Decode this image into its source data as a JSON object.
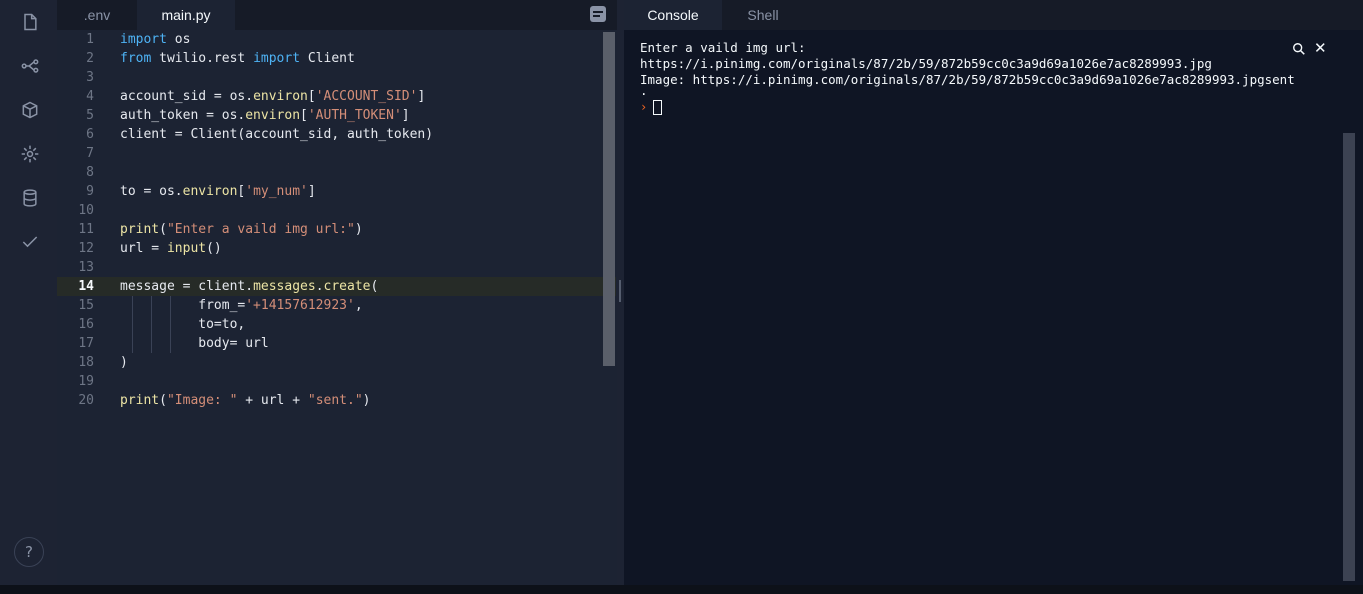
{
  "editor": {
    "tabs": [
      ".env",
      "main.py"
    ],
    "active_tab": "main.py",
    "active_line": 14,
    "lines": [
      [
        {
          "t": "import",
          "c": "kw"
        },
        {
          "t": " os",
          "c": ""
        }
      ],
      [
        {
          "t": "from",
          "c": "kw"
        },
        {
          "t": " twilio.rest ",
          "c": ""
        },
        {
          "t": "import",
          "c": "kw"
        },
        {
          "t": " Client",
          "c": ""
        }
      ],
      [],
      [
        {
          "t": "account_sid = os.",
          "c": ""
        },
        {
          "t": "environ",
          "c": "fn"
        },
        {
          "t": "[",
          "c": ""
        },
        {
          "t": "'ACCOUNT_SID'",
          "c": "str"
        },
        {
          "t": "]",
          "c": ""
        }
      ],
      [
        {
          "t": "auth_token = os.",
          "c": ""
        },
        {
          "t": "environ",
          "c": "fn"
        },
        {
          "t": "[",
          "c": ""
        },
        {
          "t": "'AUTH_TOKEN'",
          "c": "str"
        },
        {
          "t": "]",
          "c": ""
        }
      ],
      [
        {
          "t": "client = Client(account_sid, auth_token)",
          "c": ""
        }
      ],
      [],
      [],
      [
        {
          "t": "to = os.",
          "c": ""
        },
        {
          "t": "environ",
          "c": "fn"
        },
        {
          "t": "[",
          "c": ""
        },
        {
          "t": "'my_num'",
          "c": "str"
        },
        {
          "t": "]",
          "c": ""
        }
      ],
      [],
      [
        {
          "t": "print",
          "c": "fn"
        },
        {
          "t": "(",
          "c": ""
        },
        {
          "t": "\"Enter a vaild img url:\"",
          "c": "str"
        },
        {
          "t": ")",
          "c": ""
        }
      ],
      [
        {
          "t": "url = ",
          "c": ""
        },
        {
          "t": "input",
          "c": "fn"
        },
        {
          "t": "()",
          "c": ""
        }
      ],
      [],
      [
        {
          "t": "message = client.",
          "c": ""
        },
        {
          "t": "messages",
          "c": "fn"
        },
        {
          "t": ".",
          "c": ""
        },
        {
          "t": "create",
          "c": "fn"
        },
        {
          "t": "(",
          "c": ""
        }
      ],
      [
        {
          "t": "          from_=",
          "c": ""
        },
        {
          "t": "'+14157612923'",
          "c": "str"
        },
        {
          "t": ",",
          "c": ""
        }
      ],
      [
        {
          "t": "          to=to,",
          "c": ""
        }
      ],
      [
        {
          "t": "          body= url",
          "c": ""
        }
      ],
      [
        {
          "t": ")",
          "c": ""
        }
      ],
      [],
      [
        {
          "t": "print",
          "c": "fn"
        },
        {
          "t": "(",
          "c": ""
        },
        {
          "t": "\"Image: \"",
          "c": "str"
        },
        {
          "t": " + url + ",
          "c": ""
        },
        {
          "t": "\"sent.\"",
          "c": "str"
        },
        {
          "t": ")",
          "c": ""
        }
      ]
    ]
  },
  "console": {
    "tabs": [
      "Console",
      "Shell"
    ],
    "active_tab": "Console",
    "output": [
      "Enter a vaild img url:",
      "https://i.pinimg.com/originals/87/2b/59/872b59cc0c3a9d69a1026e7ac8289993.jpg",
      "Image: https://i.pinimg.com/originals/87/2b/59/872b59cc0c3a9d69a1026e7ac8289993.jpgsent",
      "."
    ],
    "prompt_symbol": "›",
    "close_symbol": "✕"
  },
  "sidebar": {
    "icons": [
      "files-icon",
      "version-control-icon",
      "packages-icon",
      "settings-icon",
      "database-icon",
      "checkmark-icon"
    ],
    "help_label": "?"
  },
  "colors": {
    "keyword": "#4eb3f5",
    "string": "#d48e78",
    "function": "#ece4a5",
    "prompt": "#f26522"
  }
}
